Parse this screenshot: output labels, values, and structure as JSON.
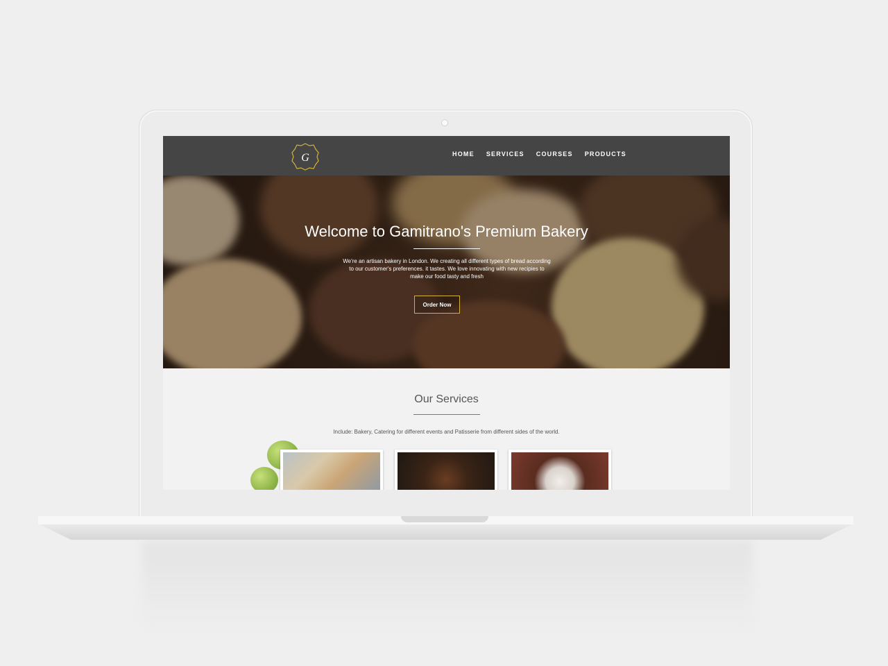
{
  "site": {
    "logo_text": "G",
    "nav": [
      "HOME",
      "SERVICES",
      "COURSES",
      "PRODUCTS"
    ]
  },
  "hero": {
    "title": "Welcome to Gamitrano's Premium Bakery",
    "text": "We're an artisan bakery in London. We creating all different types of bread according to our customer's preferences. it tastes. We love innovating with new recipies to make our food tasty and fresh",
    "button": "Order Now"
  },
  "services": {
    "title": "Our Services",
    "text": "Include: Bakery, Catering for different events and Patisserie from different sides of the world."
  },
  "colors": {
    "navbar": "#454545",
    "accent": "#d4b23a",
    "background": "#f2f2f2"
  }
}
